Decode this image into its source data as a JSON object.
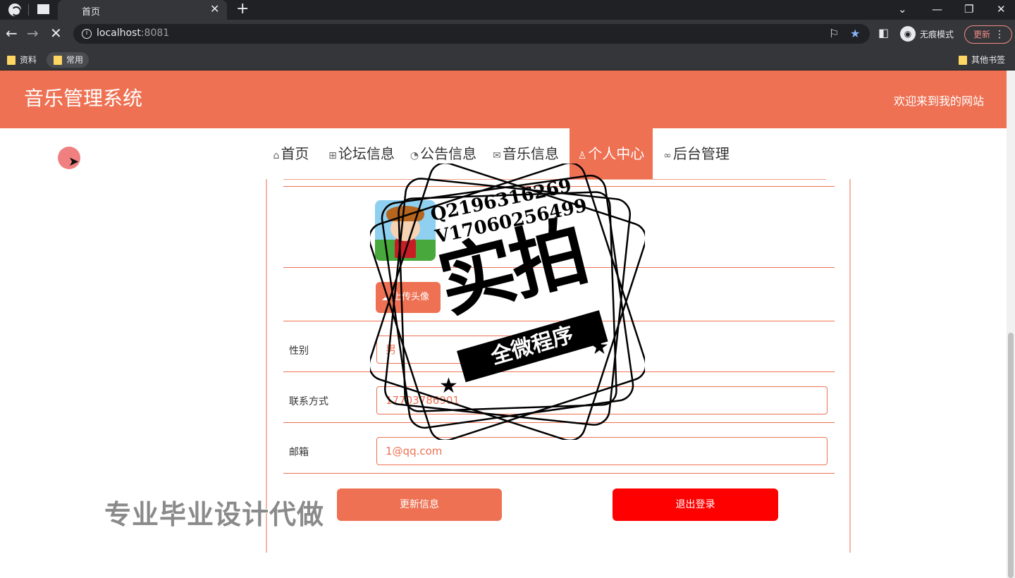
{
  "browser": {
    "tab_title": "首页",
    "url_host": "localhost",
    "url_port": ":8081",
    "profile_label": "无痕模式",
    "update_label": "更新",
    "bookmarks": [
      "资料",
      "常用"
    ],
    "other_bookmarks": "其他书签"
  },
  "site": {
    "title": "音乐管理系统",
    "welcome": "欢迎来到我的网站"
  },
  "nav": {
    "items": [
      "首页",
      "论坛信息",
      "公告信息",
      "音乐信息",
      "个人中心",
      "后台管理"
    ],
    "active_index": 4
  },
  "profile_form": {
    "upload_label": "上传头像",
    "gender_label": "性别",
    "gender_value": "男",
    "contact_label": "联系方式",
    "contact_value": "17703786901",
    "email_label": "邮箱",
    "email_value": "1@qq.com",
    "update_button": "更新信息",
    "logout_button": "退出登录"
  },
  "colors": {
    "accent": "#ee7153",
    "logout": "#ff0000"
  },
  "watermark": {
    "contact_q": "Q2196316269",
    "contact_v": "V17060256499",
    "big_text": "实拍",
    "banner_text": "全微程序",
    "bottom_text": "专业毕业设计代做"
  }
}
